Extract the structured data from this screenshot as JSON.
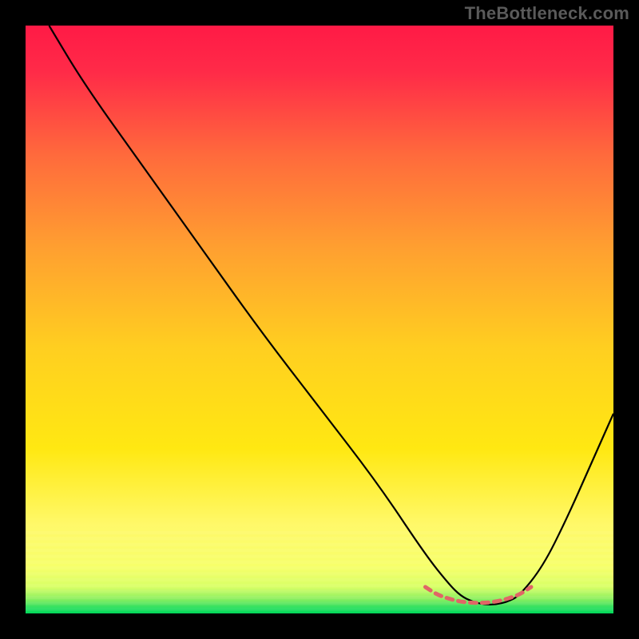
{
  "watermark": "TheBottleneck.com",
  "chart_data": {
    "type": "line",
    "title": "",
    "xlabel": "",
    "ylabel": "",
    "xlim": [
      0,
      100
    ],
    "ylim": [
      0,
      100
    ],
    "grid": false,
    "legend": false,
    "background_gradient": {
      "top_color": "#ff1a46",
      "mid_color": "#ffd800",
      "band_color": "#ffff66",
      "bottom_color": "#00e060"
    },
    "series": [
      {
        "name": "bottleneck-curve",
        "color": "#000000",
        "x": [
          4,
          10,
          20,
          30,
          40,
          50,
          60,
          68,
          72,
          74,
          76,
          78,
          80,
          82,
          84,
          88,
          92,
          96,
          100
        ],
        "y": [
          100,
          90,
          76,
          62,
          48,
          35,
          22,
          10,
          5,
          3,
          2,
          1.5,
          1.5,
          2,
          3,
          8,
          16,
          25,
          34
        ]
      },
      {
        "name": "optimal-range-marker",
        "color": "#e06666",
        "style": "dashed",
        "x": [
          68,
          70,
          72,
          74,
          76,
          78,
          80,
          82,
          84,
          86
        ],
        "y": [
          4.5,
          3.2,
          2.5,
          2.0,
          1.8,
          1.8,
          2.0,
          2.5,
          3.2,
          4.5
        ]
      }
    ]
  }
}
